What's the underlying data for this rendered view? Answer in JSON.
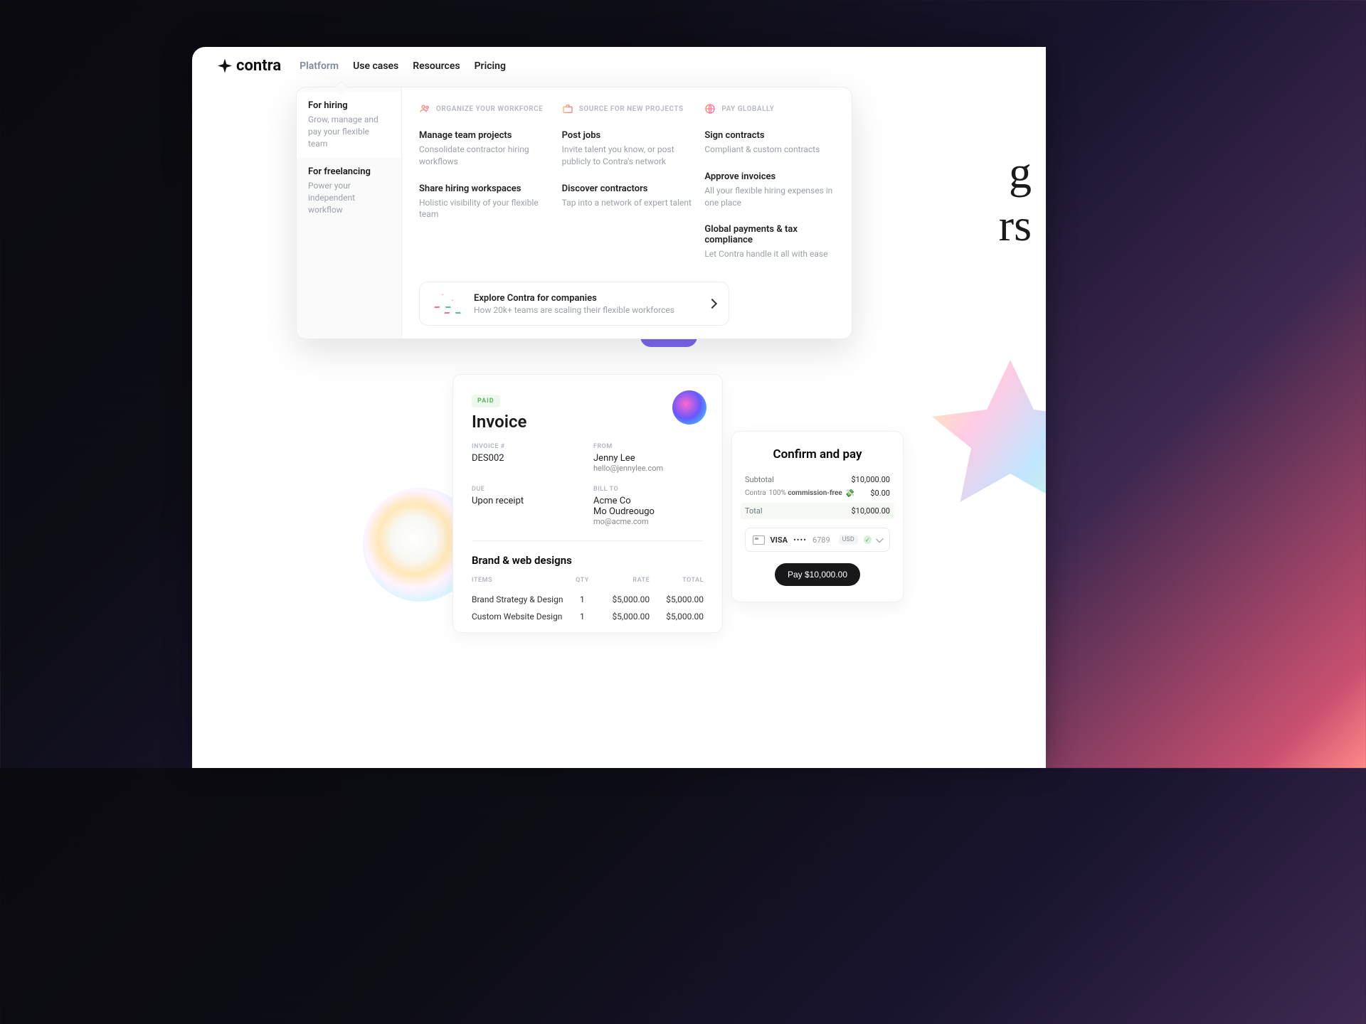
{
  "logo": "contra",
  "nav": {
    "platform": "Platform",
    "use_cases": "Use cases",
    "resources": "Resources",
    "pricing": "Pricing"
  },
  "mega": {
    "left": [
      {
        "title": "For hiring",
        "sub": "Grow, manage and pay your flexible team"
      },
      {
        "title": "For freelancing",
        "sub": "Power your independent workflow"
      }
    ],
    "cols": [
      {
        "header": "ORGANIZE YOUR WORKFORCE",
        "links": [
          {
            "title": "Manage team projects",
            "desc": "Consolidate contractor hiring workflows"
          },
          {
            "title": "Share hiring workspaces",
            "desc": "Holistic visibility of your flexible team"
          }
        ]
      },
      {
        "header": "SOURCE FOR NEW PROJECTS",
        "links": [
          {
            "title": "Post jobs",
            "desc": "Invite talent you know, or post publicly to Contra's network"
          },
          {
            "title": "Discover contractors",
            "desc": "Tap into a network of expert talent"
          }
        ]
      },
      {
        "header": "PAY GLOBALLY",
        "links": [
          {
            "title": "Sign contracts",
            "desc": "Compliant & custom contracts"
          },
          {
            "title": "Approve invoices",
            "desc": "All your flexible hiring expenses in one place"
          },
          {
            "title": "Global payments & tax compliance",
            "desc": "Let Contra handle it all with ease"
          }
        ]
      }
    ],
    "footer": {
      "title": "Explore Contra for companies",
      "desc": "How 20k+ teams are scaling their flexible workforces"
    }
  },
  "hero": {
    "line1_fragment": "g",
    "line2_fragment": "rs"
  },
  "invoice": {
    "badge": "PAID",
    "title": "Invoice",
    "number_label": "INVOICE #",
    "number": "DES002",
    "from_label": "FROM",
    "from_name": "Jenny Lee",
    "from_email": "hello@jennylee.com",
    "due_label": "DUE",
    "due": "Upon receipt",
    "billto_label": "BILL TO",
    "billto_company": "Acme Co",
    "billto_name": "Mo Oudreougo",
    "billto_email": "mo@acme.com",
    "section": "Brand & web designs",
    "headers": {
      "items": "ITEMS",
      "qty": "QTY",
      "rate": "RATE",
      "total": "TOTAL"
    },
    "rows": [
      {
        "item": "Brand Strategy & Design",
        "qty": "1",
        "rate": "$5,000.00",
        "total": "$5,000.00"
      },
      {
        "item": "Custom Website Design",
        "qty": "1",
        "rate": "$5,000.00",
        "total": "$5,000.00"
      }
    ]
  },
  "pay": {
    "title": "Confirm and pay",
    "subtotal_label": "Subtotal",
    "subtotal": "$10,000.00",
    "fee_brand": "Contra",
    "fee_copy_prefix": "100% ",
    "fee_copy_bold": "commission-free",
    "fee_emoji": "💸",
    "fee_val": "$0.00",
    "total_label": "Total",
    "total": "$10,000.00",
    "method": {
      "brand": "VISA",
      "dots": "••••",
      "last4": "6789",
      "currency": "USD"
    },
    "button": "Pay $10,000.00"
  }
}
